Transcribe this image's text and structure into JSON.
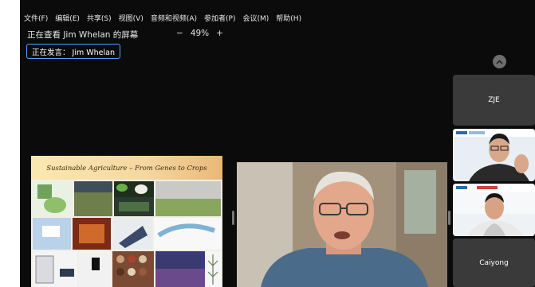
{
  "menu": [
    "文件(F)",
    "编辑(E)",
    "共享(S)",
    "视图(V)",
    "音频和视频(A)",
    "参加者(P)",
    "会议(M)",
    "帮助(H)"
  ],
  "viewing_label": "正在查看 Jim Whelan 的屏幕",
  "zoom": {
    "minus": "−",
    "level": "49%",
    "plus": "+"
  },
  "speaking_label": "正在发言： Jim Whelan",
  "slide": {
    "title": "Sustainable Agriculture – From Genes to Crops"
  },
  "participants": [
    {
      "name": "ZJE",
      "video": false
    },
    {
      "name": "",
      "video": true
    },
    {
      "name": "",
      "video": true
    },
    {
      "name": "Caiyong",
      "video": false
    }
  ],
  "colors": {
    "background": "#0b0b0b",
    "speaker_border": "#5aa0ff",
    "tile_bg": "#3a3a3a"
  }
}
